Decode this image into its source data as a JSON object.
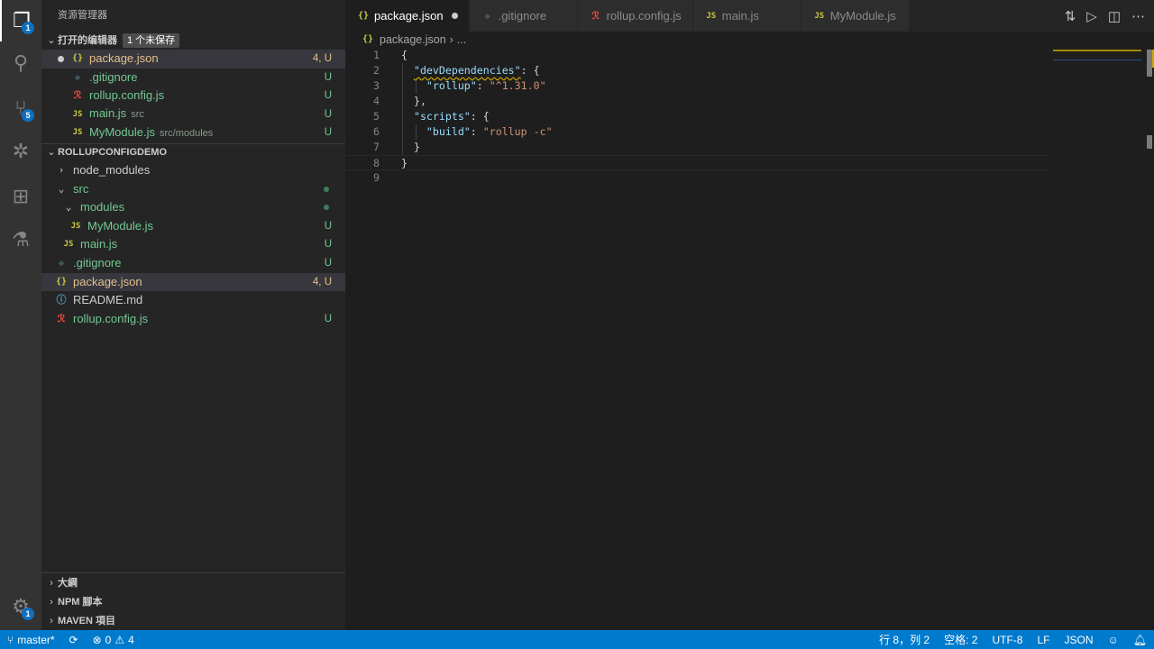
{
  "activity_bar": {
    "explorer_badge": "1",
    "scm_badge": "5",
    "settings_badge": "1"
  },
  "sidebar": {
    "title": "资源管理器",
    "open_editors": {
      "label": "打开的编辑器",
      "unsaved": "1 个未保存",
      "items": [
        {
          "name": "package.json",
          "icon": "json",
          "status": "4, U",
          "modified": true
        },
        {
          "name": ".gitignore",
          "icon": "git",
          "status": "U"
        },
        {
          "name": "rollup.config.js",
          "icon": "rollup",
          "status": "U"
        },
        {
          "name": "main.js",
          "desc": "src",
          "icon": "js",
          "status": "U"
        },
        {
          "name": "MyModule.js",
          "desc": "src/modules",
          "icon": "js",
          "status": "U"
        }
      ]
    },
    "project": {
      "label": "ROLLUPCONFIGDEMO",
      "items": [
        {
          "name": "node_modules",
          "type": "folder-collapsed",
          "depth": 0
        },
        {
          "name": "src",
          "type": "folder-open",
          "depth": 0,
          "status": "dot"
        },
        {
          "name": "modules",
          "type": "folder-open",
          "depth": 1,
          "status": "dot"
        },
        {
          "name": "MyModule.js",
          "icon": "js",
          "depth": 2,
          "status": "U"
        },
        {
          "name": "main.js",
          "icon": "js",
          "depth": 1,
          "status": "U"
        },
        {
          "name": ".gitignore",
          "icon": "git",
          "depth": 0,
          "status": "U"
        },
        {
          "name": "package.json",
          "icon": "json",
          "depth": 0,
          "status": "4, U",
          "selected": true
        },
        {
          "name": "README.md",
          "icon": "info",
          "depth": 0
        },
        {
          "name": "rollup.config.js",
          "icon": "rollup",
          "depth": 0,
          "status": "U"
        }
      ]
    },
    "bottom_sections": [
      "大綱",
      "NPM 腳本",
      "MAVEN 項目"
    ]
  },
  "tabs": [
    {
      "name": "package.json",
      "icon": "json",
      "active": true,
      "modified": true
    },
    {
      "name": ".gitignore",
      "icon": "git"
    },
    {
      "name": "rollup.config.js",
      "icon": "rollup"
    },
    {
      "name": "main.js",
      "icon": "js"
    },
    {
      "name": "MyModule.js",
      "icon": "js"
    }
  ],
  "breadcrumb": {
    "file": "package.json",
    "sep": "›",
    "rest": "..."
  },
  "code": [
    [
      [
        "p",
        "{"
      ]
    ],
    [
      [
        "p",
        "  "
      ],
      [
        "kw",
        "\"devDependencies\""
      ],
      [
        "p",
        ": {"
      ]
    ],
    [
      [
        "p",
        "    "
      ],
      [
        "k",
        "\"rollup\""
      ],
      [
        "p",
        ": "
      ],
      [
        "s",
        "\"^1.31.0\""
      ]
    ],
    [
      [
        "p",
        "  },"
      ]
    ],
    [
      [
        "p",
        "  "
      ],
      [
        "k",
        "\"scripts\""
      ],
      [
        "p",
        ": {"
      ]
    ],
    [
      [
        "p",
        "    "
      ],
      [
        "k",
        "\"build\""
      ],
      [
        "p",
        ": "
      ],
      [
        "s",
        "\"rollup -c\""
      ]
    ],
    [
      [
        "p",
        "  }"
      ]
    ],
    [
      [
        "p",
        "}"
      ]
    ],
    []
  ],
  "status_bar": {
    "branch": "master*",
    "errors": "0",
    "warnings": "4",
    "position": "行 8，列 2",
    "indent": "空格: 2",
    "encoding": "UTF-8",
    "eol": "LF",
    "language": "JSON"
  },
  "colors": {
    "accent": "#007acc",
    "untracked": "#73c991",
    "modified": "#e2c08d"
  }
}
